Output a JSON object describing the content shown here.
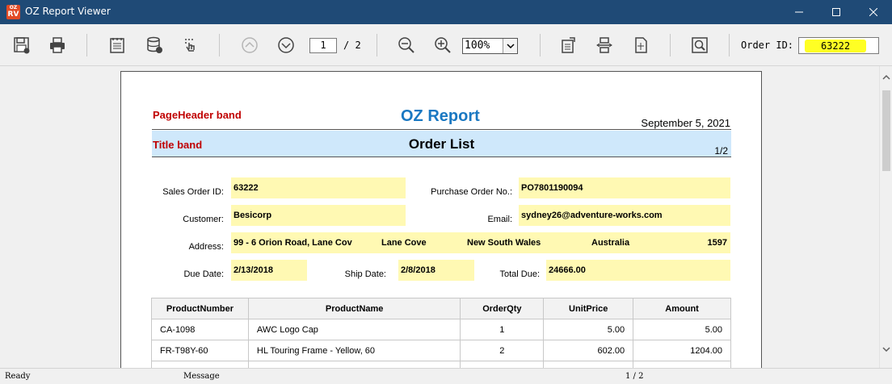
{
  "window": {
    "title": "OZ Report Viewer",
    "icon_top": "OZ",
    "icon_bottom": "RV"
  },
  "toolbar": {
    "icons": [
      "save-icon",
      "print-icon",
      "notepad-icon",
      "database-icon",
      "touch-icon",
      "prev-page-icon",
      "next-page-icon",
      "zoom-out-icon",
      "zoom-in-icon",
      "export-icon",
      "fit-width-icon",
      "fit-page-icon",
      "find-icon"
    ],
    "current_page": "1",
    "total_pages": "/ 2",
    "zoom": "100%",
    "order_id_label": "Order ID:",
    "order_id_value": "63222"
  },
  "report": {
    "page_header_band_label": "PageHeader band",
    "title_band_label": "Title band",
    "title": "OZ Report",
    "date": "September 5, 2021",
    "heading": "Order List",
    "page_number": "1/2",
    "fields": {
      "sales_order_id_label": "Sales Order ID:",
      "sales_order_id": "63222",
      "purchase_order_label": "Purchase Order No.:",
      "purchase_order": "PO7801190094",
      "customer_label": "Customer:",
      "customer": "Besicorp",
      "email_label": "Email:",
      "email": "sydney26@adventure-works.com",
      "address_label": "Address:",
      "address_street": "99 - 6 Orion Road, Lane Cov",
      "address_city": "Lane Cove",
      "address_state": "New South Wales",
      "address_country": "Australia",
      "address_postal": "1597",
      "due_date_label": "Due Date:",
      "due_date": "2/13/2018",
      "ship_date_label": "Ship Date:",
      "ship_date": "2/8/2018",
      "total_due_label": "Total Due:",
      "total_due": "24666.00"
    },
    "table": {
      "headers": [
        "ProductNumber",
        "ProductName",
        "OrderQty",
        "UnitPrice",
        "Amount"
      ],
      "rows": [
        [
          "CA-1098",
          "AWC Logo Cap",
          "1",
          "5.00",
          "5.00"
        ],
        [
          "FR-T98Y-60",
          "HL Touring Frame - Yellow, 60",
          "2",
          "602.00",
          "1204.00"
        ]
      ]
    }
  },
  "status": {
    "ready": "Ready",
    "message": "Message",
    "page": "1 / 2"
  }
}
